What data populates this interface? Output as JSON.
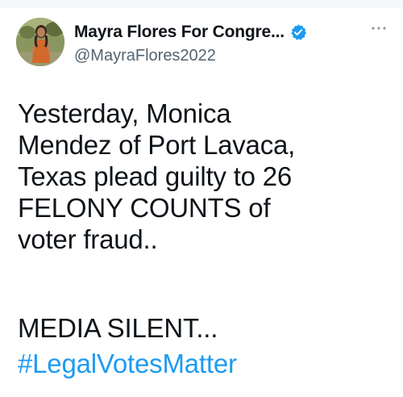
{
  "author": {
    "display_name": "Mayra Flores For Congre...",
    "handle": "@MayraFlores2022",
    "avatar_icon": "profile-photo",
    "verified_icon": "verified-badge-icon",
    "verified_color": "#1d9bf0"
  },
  "menu": {
    "icon": "more-options-icon"
  },
  "tweet": {
    "lines": [
      "Yesterday, Monica",
      "Mendez of Port Lavaca,",
      "Texas plead guilty to 26",
      "FELONY COUNTS of",
      "voter fraud.."
    ],
    "second_paragraph": "MEDIA SILENT...",
    "hashtag": "#LegalVotesMatter",
    "hashtag_color": "#1d9bf0"
  }
}
